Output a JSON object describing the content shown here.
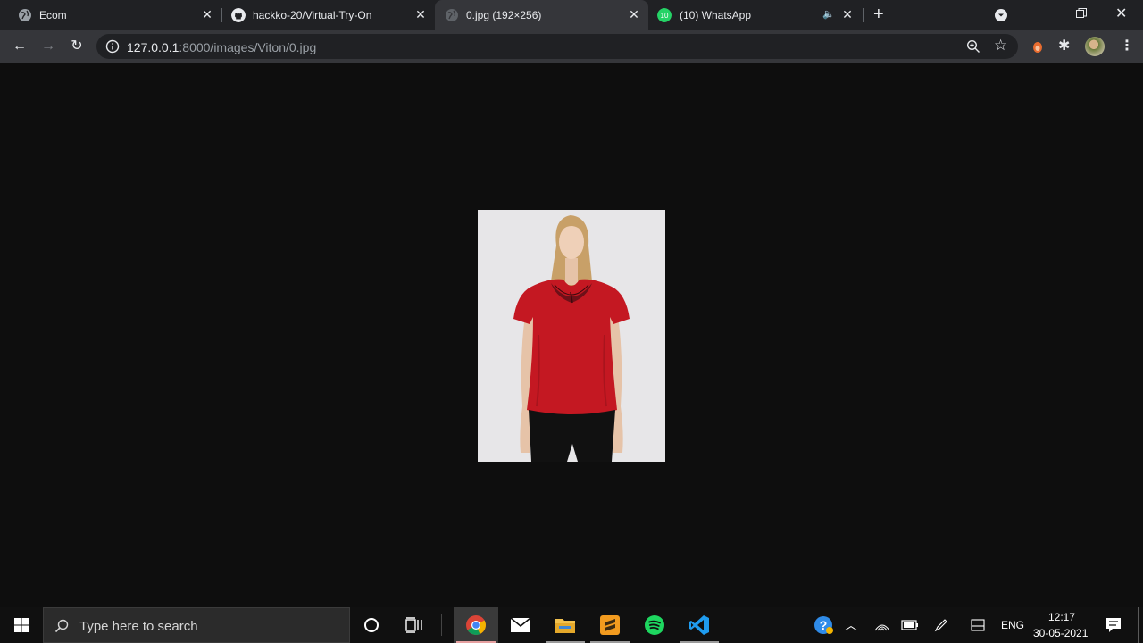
{
  "browser": {
    "tabs": [
      {
        "title": "Ecom",
        "active": false
      },
      {
        "title": "hackko-20/Virtual-Try-On",
        "active": false
      },
      {
        "title": "0.jpg (192×256)",
        "active": true
      },
      {
        "title": "(10) WhatsApp",
        "active": false,
        "badge": "10"
      }
    ],
    "url_host": "127.0.0.1",
    "url_rest": ":8000/images/Viton/0.jpg"
  },
  "taskbar": {
    "search_placeholder": "Type here to search",
    "language": "ENG",
    "time": "12:17",
    "date": "30-05-2021"
  },
  "colors": {
    "accent_red": "#c41822",
    "whatsapp_green": "#25d366"
  }
}
